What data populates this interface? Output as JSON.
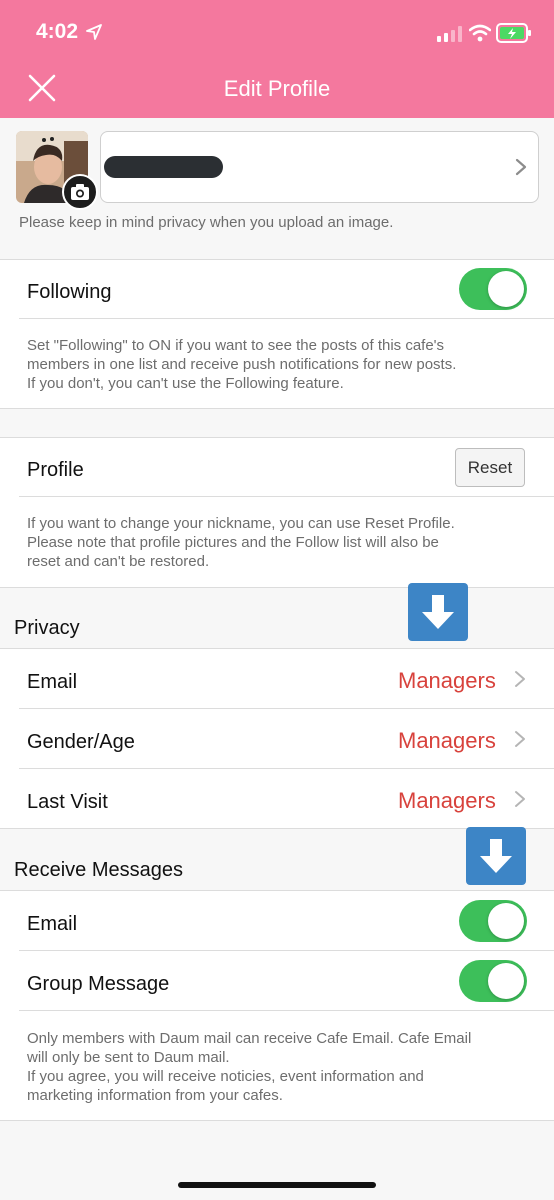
{
  "status_bar": {
    "time": "4:02"
  },
  "header": {
    "title": "Edit Profile"
  },
  "profile_top": {
    "privacy_note": "Please keep in mind privacy when you upload an image."
  },
  "following": {
    "label": "Following",
    "enabled": true,
    "description": "Set \"Following\" to ON if you want to see the posts of this cafe's\nmembers in one list and receive push notifications for new posts.\nIf you don't, you can't use the Following feature."
  },
  "profile": {
    "label": "Profile",
    "reset_label": "Reset",
    "description": "If you want to change your nickname, you can use Reset Profile.\nPlease note that profile pictures and the Follow list will also be\nreset and can't be restored."
  },
  "privacy": {
    "title": "Privacy",
    "items": [
      {
        "label": "Email",
        "value": "Managers"
      },
      {
        "label": "Gender/Age",
        "value": "Managers"
      },
      {
        "label": "Last Visit",
        "value": "Managers"
      }
    ]
  },
  "receive_messages": {
    "title": "Receive Messages",
    "items": [
      {
        "label": "Email",
        "enabled": true
      },
      {
        "label": "Group Message",
        "enabled": true
      }
    ],
    "description": "Only members with Daum mail can receive Cafe Email. Cafe Email\nwill only be sent to Daum mail.\nIf you agree, you will receive noticies, event information and\nmarketing information from your cafes."
  },
  "colors": {
    "header": "#f4789e",
    "accent_red": "#d8423c",
    "toggle_on": "#3dbf5a",
    "arrow_blue": "#3d85c6"
  }
}
